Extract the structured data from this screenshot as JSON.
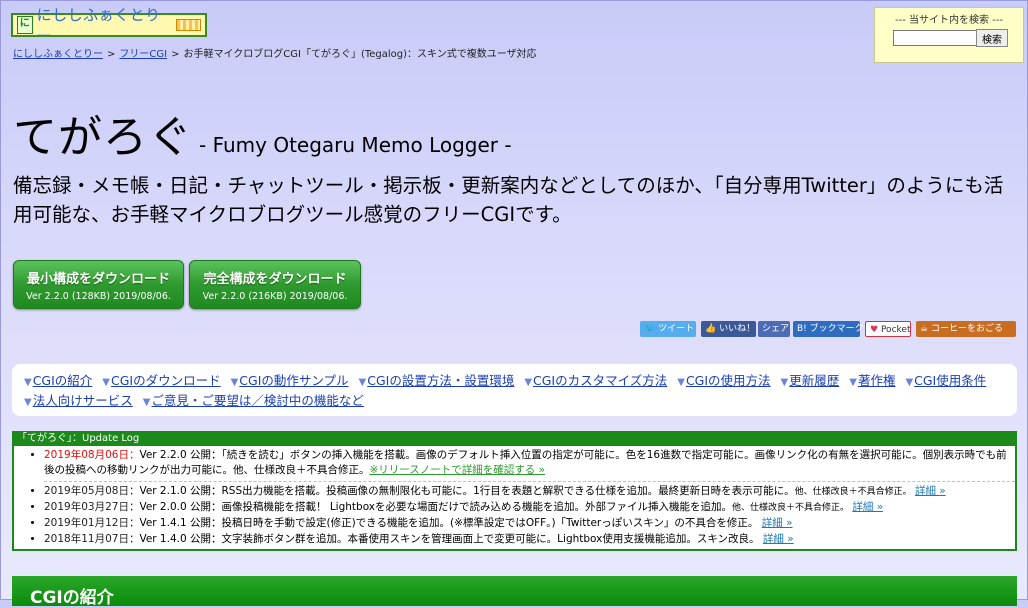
{
  "logo": {
    "mark": "に",
    "text": "にししふぁくとりー"
  },
  "breadcrumb": {
    "home": "にししふぁくとりー",
    "sep": ">",
    "cgi": "フリーCGI",
    "current": "お手軽マイクロブログCGI「てがろぐ」(Tegalog)：スキン式で複数ユーザ対応"
  },
  "search": {
    "label": "--- 当サイト内を検索 ---",
    "value": "",
    "button": "検索"
  },
  "title": {
    "main": "てがろぐ",
    "sub": "- Fumy Otegaru Memo Logger -"
  },
  "lead": "備忘録・メモ帳・日記・チャットツール・掲示板・更新案内などとしてのほか、「自分専用Twitter」のようにも活用可能な、お手軽マイクロブログツール感覚のフリーCGIです。",
  "downloads": [
    {
      "title": "最小構成をダウンロード",
      "version": "Ver 2.2.0 (128KB) 2019/08/06."
    },
    {
      "title": "完全構成をダウンロード",
      "version": "Ver 2.2.0 (216KB) 2019/08/06."
    }
  ],
  "share": {
    "tweet": "ツイート",
    "like": "いいね！",
    "share": "シェア",
    "hatena": "B! ブックマーク",
    "pocket": "Pocket",
    "coffee": "コーヒーをおごる"
  },
  "nav": [
    "CGIの紹介",
    "CGIのダウンロード",
    "CGIの動作サンプル",
    "CGIの設置方法・設置環境",
    "CGIのカスタマイズ方法",
    "CGIの使用方法",
    "更新履歴",
    "著作権",
    "CGI使用条件",
    "法人向けサービス",
    "ご意見・ご要望は／検討中の機能など"
  ],
  "log": {
    "header": "「てがろぐ」：Update Log",
    "items": [
      {
        "date": "2019年08月06日：",
        "text": "Ver 2.2.0 公開：「続きを読む」ボタンの挿入機能を搭載。画像のデフォルト挿入位置の指定が可能に。色を16進数で指定可能に。画像リンク化の有無を選択可能に。個別表示時でも前後の投稿への移動リンクが出力可能に。他、仕様改良＋不具合修正。",
        "small": "",
        "link": "※リリースノートで詳細を確認する »"
      },
      {
        "date": "2019年05月08日：",
        "text": "Ver 2.1.0 公開：RSS出力機能を搭載。投稿画像の無制限化も可能に。1行目を表題と解釈できる仕様を追加。最終更新日時を表示可能に。",
        "small": "他、仕様改良＋不具合修正。",
        "link": "詳細 »"
      },
      {
        "date": "2019年03月27日：",
        "text": "Ver 2.0.0 公開：画像投稿機能を搭載！ Lightboxを必要な場面だけで読み込める機能を追加。外部ファイル挿入機能を追加。",
        "small": "他、仕様改良＋不具合修正。",
        "link": "詳細 »"
      },
      {
        "date": "2019年01月12日：",
        "text": "Ver 1.4.1 公開：投稿日時を手動で設定(修正)できる機能を追加。(※標準設定ではOFF。)「Twitterっぽいスキン」の不具合を修正。",
        "small": "",
        "link": "詳細 »"
      },
      {
        "date": "2018年11月07日：",
        "text": "Ver 1.4.0 公開：文字装飾ボタン群を追加。本番使用スキンを管理画面上で変更可能に。Lightbox使用支援機能追加。スキン改良。",
        "small": "",
        "link": "詳細 »"
      }
    ]
  },
  "section_title": "CGIの紹介"
}
